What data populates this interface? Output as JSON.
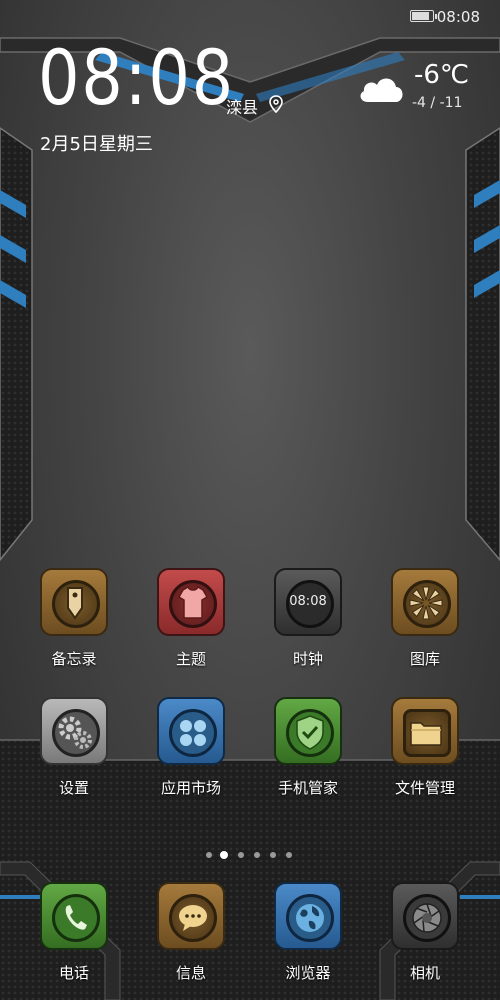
{
  "status_bar": {
    "time": "08:08",
    "battery_level": 0.75
  },
  "widget": {
    "time": "08:08",
    "location": "滦县",
    "date": "2月5日星期三",
    "temperature": "-6℃",
    "range": "-4 / -11",
    "weather_icon": "cloud-icon"
  },
  "apps": [
    {
      "label": "备忘录",
      "icon": "memo-icon"
    },
    {
      "label": "主题",
      "icon": "tshirt-icon"
    },
    {
      "label": "时钟",
      "icon": "clock-icon",
      "icon_text": "08:08"
    },
    {
      "label": "图库",
      "icon": "gallery-icon"
    },
    {
      "label": "设置",
      "icon": "gear-icon"
    },
    {
      "label": "应用市场",
      "icon": "clover-icon"
    },
    {
      "label": "手机管家",
      "icon": "shield-check-icon"
    },
    {
      "label": "文件管理",
      "icon": "folder-icon"
    }
  ],
  "dock": [
    {
      "label": "电话",
      "icon": "phone-icon"
    },
    {
      "label": "信息",
      "icon": "message-icon"
    },
    {
      "label": "浏览器",
      "icon": "globe-icon"
    },
    {
      "label": "相机",
      "icon": "camera-icon"
    }
  ],
  "page_indicator": {
    "pages": 6,
    "current": 1
  },
  "colors": {
    "accent_blue": "#2f7fbf",
    "frame_dark": "#1b1b1b"
  }
}
